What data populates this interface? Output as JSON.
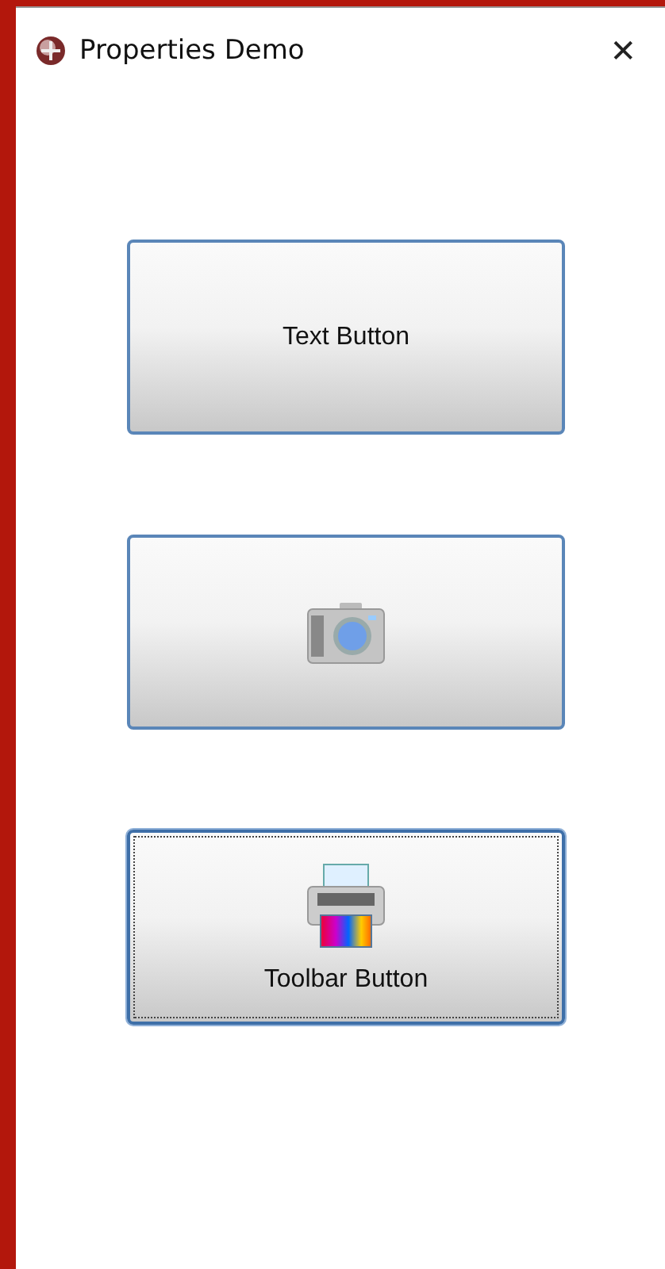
{
  "window": {
    "title": "Properties Demo",
    "close": "✕"
  },
  "buttons": [
    {
      "kind": "text",
      "label": "Text Button",
      "focused": false
    },
    {
      "kind": "camera",
      "focused": false
    },
    {
      "kind": "printer",
      "label": "Toolbar Button",
      "focused": true
    }
  ]
}
